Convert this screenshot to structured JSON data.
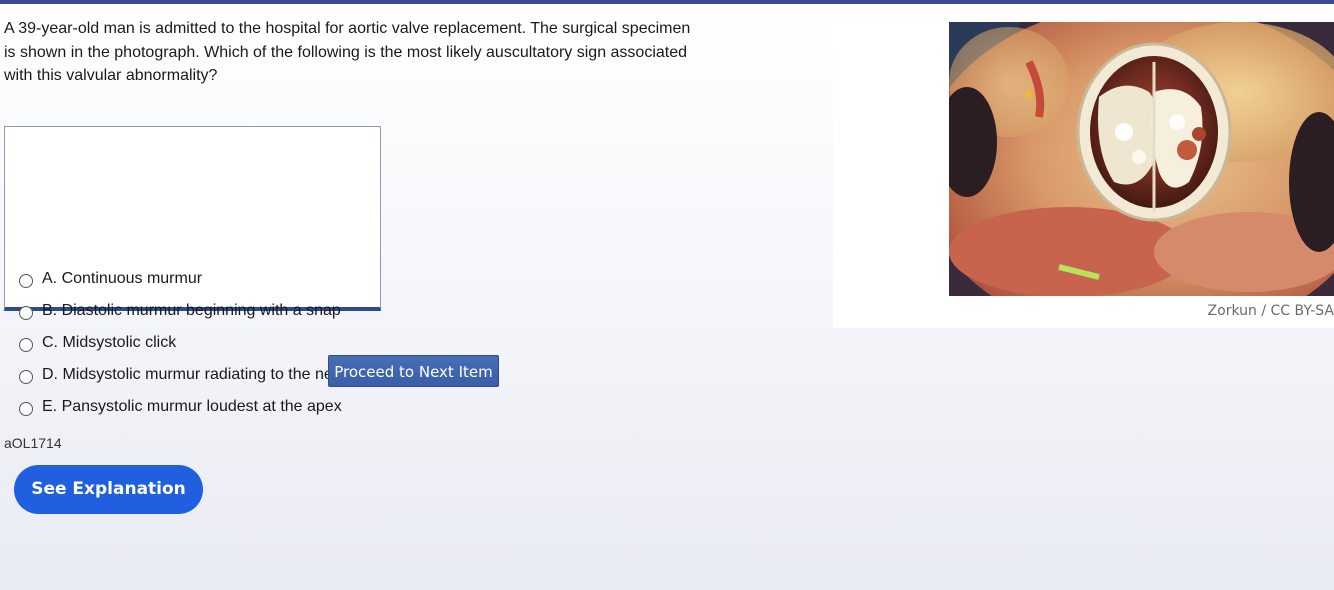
{
  "question": {
    "text": "A 39-year-old man is admitted to the hospital for aortic valve replacement. The surgical specimen is shown in the photograph. Which of the following is the most likely auscultatory sign associated with this valvular abnormality?"
  },
  "choices": [
    {
      "label": "A. Continuous murmur"
    },
    {
      "label": "B. Diastolic murmur beginning with a snap"
    },
    {
      "label": "C. Midsystolic click"
    },
    {
      "label": "D. Midsystolic murmur radiating to the neck"
    },
    {
      "label": "E. Pansystolic murmur loudest at the apex"
    }
  ],
  "figure": {
    "credit": "Zorkun / CC BY-SA"
  },
  "buttons": {
    "next_label": "Proceed to Next Item",
    "explanation_label": "See Explanation"
  },
  "item_id": "aOL1714"
}
